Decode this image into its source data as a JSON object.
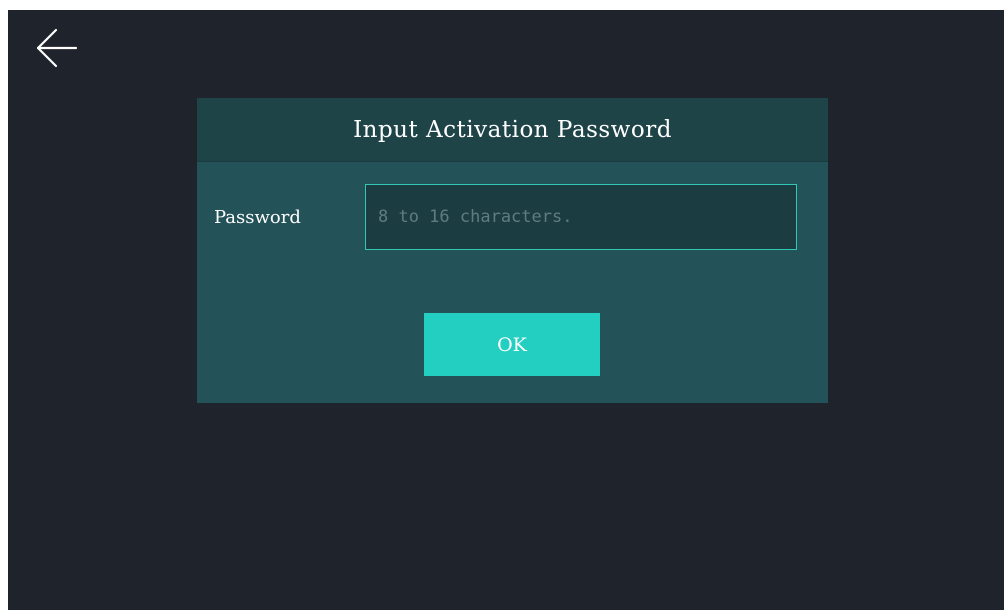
{
  "navigation": {
    "back_icon": "arrow-left-icon"
  },
  "dialog": {
    "title": "Input Activation Password",
    "password_label": "Password",
    "password_value": "",
    "password_placeholder": "8 to 16 characters.",
    "ok_label": "OK"
  },
  "colors": {
    "background": "#1f232b",
    "dialog_body": "#245259",
    "dialog_header": "#1e4448",
    "input_border": "#30c9b8",
    "button": "#22cfc0"
  }
}
